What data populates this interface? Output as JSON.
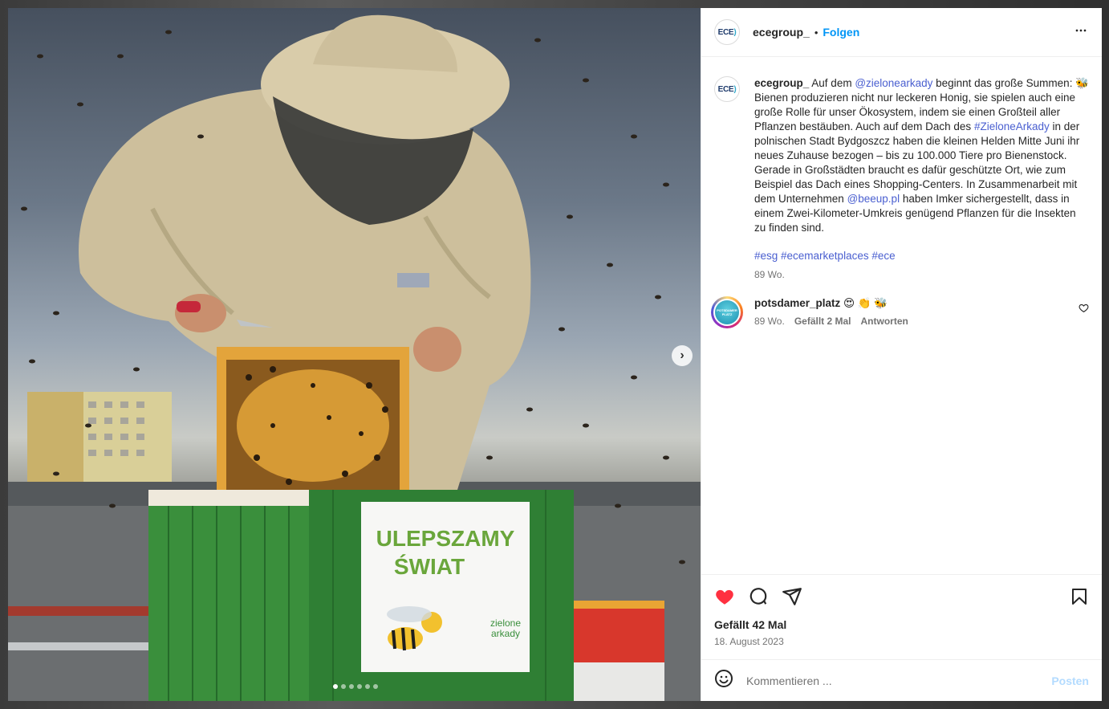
{
  "post": {
    "username": "ecegroup_",
    "avatar_text": "ECE",
    "follow_label": "Folgen",
    "more_icon": "more-horizontal-icon",
    "image_sign_line1": "ULEPSZAMY",
    "image_sign_line2": "ŚWIAT",
    "image_sign_logo_line1": "zielone",
    "image_sign_logo_line2": "arkady",
    "carousel_total": 6,
    "carousel_active": 1
  },
  "caption": {
    "username": "ecegroup_",
    "part1": "Auf dem ",
    "mention1": "@zielonearkady",
    "part2": " beginnt das große Summen: 🐝 Bienen produzieren nicht nur leckeren Honig, sie spielen auch eine große Rolle für unser Ökosystem, indem sie einen Großteil aller Pflanzen bestäuben. Auch auf dem Dach des ",
    "hashtag1": "#ZieloneArkady",
    "part3": " in der polnischen Stadt Bydgoszcz haben die kleinen Helden Mitte Juni ihr neues Zuhause bezogen – bis zu 100.000 Tiere pro Bienenstock. Gerade in Großstädten braucht es dafür geschützte Ort, wie zum Beispiel das Dach eines Shopping-Centers. In Zusammenarbeit mit dem Unternehmen ",
    "mention2": "@beeup.pl",
    "part4": " haben Imker sichergestellt, dass in einem Zwei-Kilometer-Umkreis genügend Pflanzen für die Insekten zu finden sind.",
    "hashtags": "#esg #ecemarketplaces #ece",
    "time": "89 Wo."
  },
  "comment": {
    "username": "potsdamer_platz",
    "text": "😍 👏 🐝",
    "avatar_text": "POTSDAMER PLATZ",
    "time": "89 Wo.",
    "likes": "Gefällt 2 Mal",
    "reply": "Antworten"
  },
  "actions": {
    "likes": "Gefällt 42 Mal",
    "date": "18. August 2023",
    "like_color": "#ff3040"
  },
  "add_comment": {
    "placeholder": "Kommentieren ...",
    "post_label": "Posten"
  }
}
